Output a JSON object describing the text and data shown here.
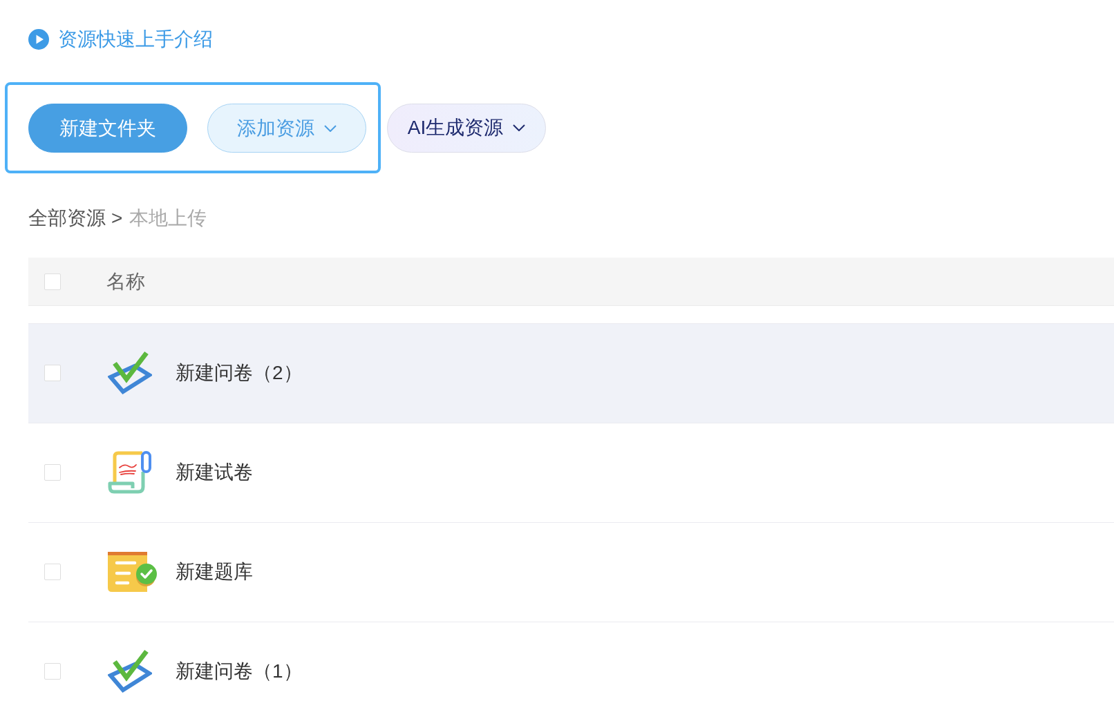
{
  "intro_link": {
    "text": "资源快速上手介绍"
  },
  "toolbar": {
    "buttons": [
      {
        "label": "新建文件夹",
        "kind": "primary",
        "dropdown": false,
        "highlighted": true
      },
      {
        "label": "添加资源",
        "kind": "secondary",
        "dropdown": true,
        "highlighted": true
      },
      {
        "label": "AI生成资源",
        "kind": "ai",
        "dropdown": true,
        "highlighted": false
      }
    ]
  },
  "breadcrumb": {
    "items": [
      {
        "label": "全部资源",
        "current": false
      },
      {
        "label": "本地上传",
        "current": true
      }
    ],
    "separator": ">"
  },
  "table": {
    "header_checkbox": {
      "checked": false
    },
    "columns": [
      {
        "label": "名称"
      }
    ],
    "rows": [
      {
        "name": "新建问卷（2）",
        "kind": "questionnaire",
        "checked": false,
        "highlighted": true
      },
      {
        "name": "新建试卷",
        "kind": "exam",
        "checked": false,
        "highlighted": false
      },
      {
        "name": "新建题库",
        "kind": "question_bank",
        "checked": false,
        "highlighted": false
      },
      {
        "name": "新建问卷（1）",
        "kind": "questionnaire",
        "checked": false,
        "highlighted": false
      }
    ]
  }
}
